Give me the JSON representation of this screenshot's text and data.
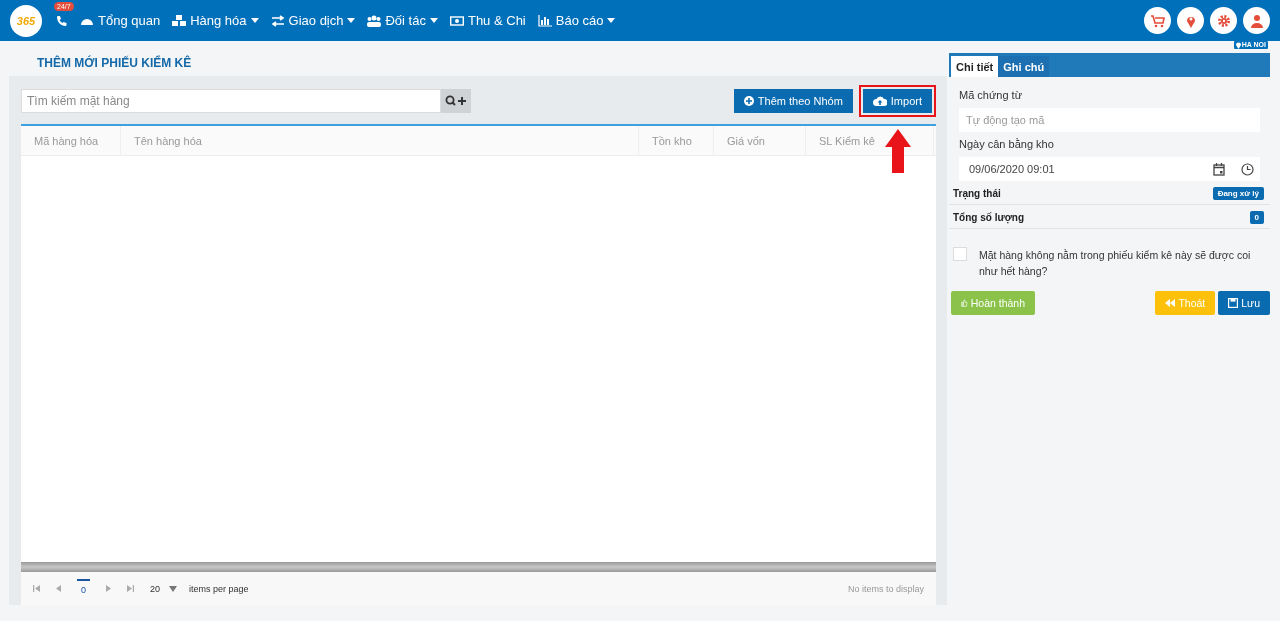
{
  "navbar": {
    "logo": "365",
    "hotline_badge": "24/7",
    "menu": [
      {
        "label": "Tổng quan",
        "dropdown": false
      },
      {
        "label": "Hàng hóa",
        "dropdown": true
      },
      {
        "label": "Giao dịch",
        "dropdown": true
      },
      {
        "label": "Đối tác",
        "dropdown": true
      },
      {
        "label": "Thu & Chi",
        "dropdown": false
      },
      {
        "label": "Báo cáo",
        "dropdown": true
      }
    ]
  },
  "location_badge": "HA NOI",
  "page_title": "THÊM MỚI PHIẾU KIỂM KÊ",
  "search": {
    "placeholder": "Tìm kiếm mặt hàng"
  },
  "toolbar_buttons": [
    {
      "label": "Thêm theo Nhóm",
      "highlighted": false
    },
    {
      "label": "Import",
      "highlighted": true
    }
  ],
  "table": {
    "columns": [
      "Mã hàng hóa",
      "Tên hàng hóa",
      "Tồn kho",
      "Giá vốn",
      "SL Kiểm kê"
    ]
  },
  "pager": {
    "page": "0",
    "page_size": "20",
    "page_size_label": "items per page",
    "status": "No items to display"
  },
  "side_tabs": [
    {
      "label": "Chi tiết",
      "selected": true
    },
    {
      "label": "Ghi chú",
      "selected": false
    }
  ],
  "code_field": {
    "label": "Mã chứng từ",
    "placeholder": "Tự động tạo mã"
  },
  "date_field": {
    "label": "Ngày cân bằng kho",
    "value": "09/06/2020 09:01"
  },
  "summary": [
    {
      "label": "Trạng thái",
      "value": "Đang xử lý"
    },
    {
      "label": "Tổng số lượng",
      "value": "0"
    }
  ],
  "out_of_stock_option": {
    "label": "Mặt hàng không nằm trong phiếu kiểm kê này sẽ được coi như hết hàng?",
    "checked": false
  },
  "actions": [
    {
      "label": "Hoàn thành",
      "kind": "success"
    },
    {
      "label": "Thoát",
      "kind": "warning"
    },
    {
      "label": "Lưu",
      "kind": "primary"
    }
  ]
}
